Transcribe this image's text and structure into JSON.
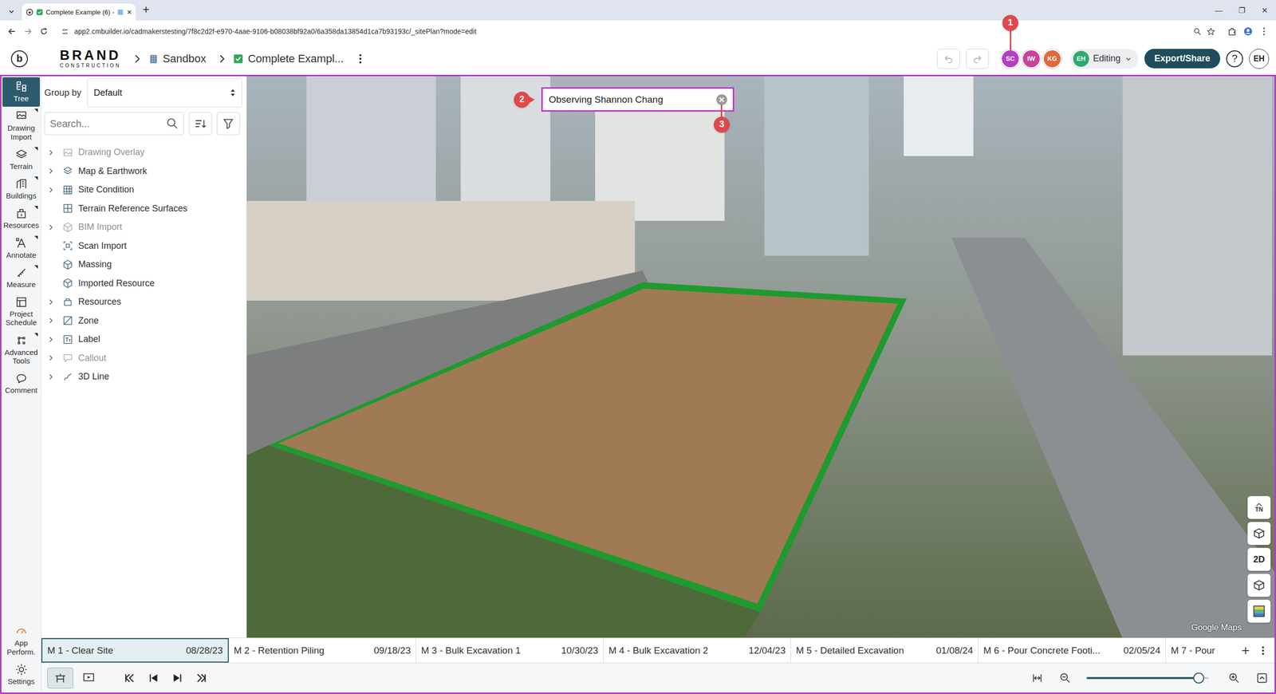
{
  "browser": {
    "tab_title": "Complete Example (6) -",
    "tab_close": "✕",
    "new_tab": "+",
    "url": "app2.cmbuilder.io/cadmakerstesting/7f8c2d2f-e970-4aae-9106-b08038bf92a0/6a358da13854d1ca7b93193c/_sitePlan?mode=edit",
    "window_controls": [
      "—",
      "❐",
      "✕"
    ]
  },
  "header": {
    "logo_mark": "b",
    "logo_text": "BRAND",
    "logo_sub": "CONSTRUCTION",
    "breadcrumbs": [
      {
        "label": "Sandbox"
      },
      {
        "label": "Complete Exampl..."
      }
    ],
    "undo_disabled": true,
    "redo_disabled": true,
    "avatars": [
      {
        "initials": "SC",
        "color": "#b43fc2",
        "callout": "1"
      },
      {
        "initials": "IW",
        "color": "#c8449c",
        "callout": ""
      },
      {
        "initials": "KG",
        "color": "#e0693a",
        "callout": ""
      }
    ],
    "mode": {
      "initials": "EH",
      "label": "Editing",
      "color": "#2fa872"
    },
    "export": "Export/Share",
    "help": "?",
    "user": "EH"
  },
  "rail": {
    "items": [
      {
        "label": "Tree",
        "selected": true,
        "has_menu": false
      },
      {
        "label": "Drawing Import",
        "selected": false,
        "has_menu": true
      },
      {
        "label": "Terrain",
        "selected": false,
        "has_menu": true
      },
      {
        "label": "Buildings",
        "selected": false,
        "has_menu": true
      },
      {
        "label": "Resources",
        "selected": false,
        "has_menu": true
      },
      {
        "label": "Annotate",
        "selected": false,
        "has_menu": true
      },
      {
        "label": "Measure",
        "selected": false,
        "has_menu": true
      },
      {
        "label": "Project Schedule",
        "selected": false,
        "has_menu": false
      },
      {
        "label": "Advanced Tools",
        "selected": false,
        "has_menu": true
      },
      {
        "label": "Comment",
        "selected": false,
        "has_menu": false
      }
    ],
    "bottom": [
      {
        "label": "App Perform."
      },
      {
        "label": "Settings"
      }
    ]
  },
  "tree_panel": {
    "group_by_label": "Group by",
    "group_by_value": "Default",
    "search_placeholder": "Search...",
    "items": [
      {
        "label": "Drawing Overlay",
        "expandable": true,
        "expanded": false,
        "greyed": true
      },
      {
        "label": "Map & Earthwork",
        "expandable": true,
        "expanded": false,
        "greyed": false
      },
      {
        "label": "Site Condition",
        "expandable": true,
        "expanded": false,
        "greyed": false
      },
      {
        "label": "Terrain Reference Surfaces",
        "expandable": false,
        "expanded": false,
        "greyed": false
      },
      {
        "label": "BIM Import",
        "expandable": true,
        "expanded": false,
        "greyed": true
      },
      {
        "label": "Scan Import",
        "expandable": false,
        "expanded": false,
        "greyed": false
      },
      {
        "label": "Massing",
        "expandable": false,
        "expanded": false,
        "greyed": false
      },
      {
        "label": "Imported Resource",
        "expandable": false,
        "expanded": false,
        "greyed": false
      },
      {
        "label": "Resources",
        "expandable": true,
        "expanded": false,
        "greyed": false
      },
      {
        "label": "Zone",
        "expandable": true,
        "expanded": false,
        "greyed": false
      },
      {
        "label": "Label",
        "expandable": true,
        "expanded": false,
        "greyed": false
      },
      {
        "label": "Callout",
        "expandable": true,
        "expanded": false,
        "greyed": true
      },
      {
        "label": "3D Line",
        "expandable": true,
        "expanded": false,
        "greyed": false
      }
    ]
  },
  "viewport": {
    "observer": {
      "text": "Observing Shannon Chang",
      "callout": "2",
      "close_callout": "3"
    },
    "attribution": "Google Maps",
    "controls": [
      {
        "kind": "compass",
        "label": "TN"
      },
      {
        "kind": "icon",
        "label": ""
      },
      {
        "kind": "text",
        "label": "2D"
      },
      {
        "kind": "icon",
        "label": ""
      },
      {
        "kind": "palette",
        "label": ""
      }
    ]
  },
  "timeline": {
    "milestones": [
      {
        "name": "M 1 - Clear Site",
        "date": "08/28/23",
        "selected": true
      },
      {
        "name": "M 2 - Retention Piling",
        "date": "09/18/23",
        "selected": false
      },
      {
        "name": "M 3 - Bulk Excavation 1",
        "date": "10/30/23",
        "selected": false
      },
      {
        "name": "M 4 - Bulk Excavation 2",
        "date": "12/04/23",
        "selected": false
      },
      {
        "name": "M 5 - Detailed Excavation",
        "date": "01/08/24",
        "selected": false
      },
      {
        "name": "M 6 - Pour Concrete Footi...",
        "date": "02/05/24",
        "selected": false
      },
      {
        "name": "M 7 - Pour",
        "date": "",
        "selected": false
      }
    ],
    "add": "+"
  },
  "toolbar": {
    "view_modes": [
      {
        "selected": true
      },
      {
        "selected": false
      }
    ],
    "zoom_level": 0.92
  }
}
